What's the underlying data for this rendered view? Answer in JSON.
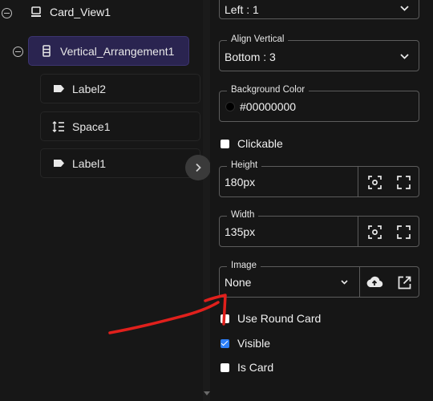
{
  "tree": {
    "nodes": [
      {
        "label": "Card_View1",
        "icon": "card-icon"
      },
      {
        "label": "Vertical_Arrangement1",
        "icon": "vertical-arrangement-icon",
        "selected": true
      },
      {
        "label": "Label2",
        "icon": "label-tag-icon"
      },
      {
        "label": "Space1",
        "icon": "space-icon"
      },
      {
        "label": "Label1",
        "icon": "label-tag-icon"
      }
    ]
  },
  "props": {
    "align_horizontal": {
      "value": "Left : 1"
    },
    "align_vertical": {
      "legend": "Align Vertical",
      "value": "Bottom : 3"
    },
    "background_color": {
      "legend": "Background Color",
      "value": "#00000000",
      "swatch": "#000000"
    },
    "clickable": {
      "label": "Clickable",
      "checked": false
    },
    "height": {
      "legend": "Height",
      "value": "180px"
    },
    "width": {
      "legend": "Width",
      "value": "135px"
    },
    "image": {
      "legend": "Image",
      "value": "None"
    },
    "use_round_card": {
      "label": "Use Round Card",
      "checked": false
    },
    "visible": {
      "label": "Visible",
      "checked": true
    },
    "is_card": {
      "label": "Is Card",
      "checked": false
    }
  },
  "colors": {
    "accent": "#2d7ff9",
    "selected_bg": "#2a2450",
    "annotation": "#e0201c"
  }
}
